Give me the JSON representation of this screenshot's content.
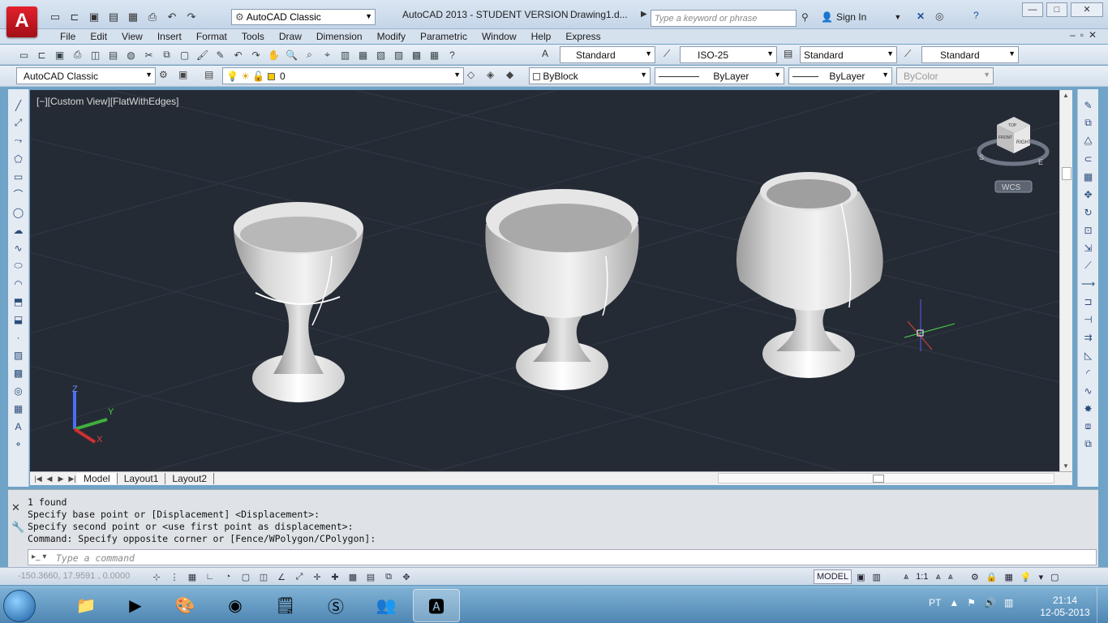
{
  "window": {
    "title": "AutoCAD 2013 - STUDENT VERSION",
    "document": "Drawing1.d...",
    "workspace": "AutoCAD Classic",
    "search_placeholder": "Type a keyword or phrase",
    "sign_in": "Sign In",
    "app_logo": "A"
  },
  "menu": [
    "File",
    "Edit",
    "View",
    "Insert",
    "Format",
    "Tools",
    "Draw",
    "Dimension",
    "Modify",
    "Parametric",
    "Window",
    "Help",
    "Express"
  ],
  "toolbar": {
    "text_style": "Standard",
    "dim_style": "ISO-25",
    "table_style": "Standard",
    "multileader_style": "Standard",
    "workspace": "AutoCAD Classic",
    "layer": "0",
    "color": "ByBlock",
    "linetype": "ByLayer",
    "lineweight": "ByLayer",
    "plotstyle": "ByColor"
  },
  "viewport": {
    "label": "[−][Custom View][FlatWithEdges]",
    "viewcube_face": "RIGHT",
    "viewcube_front": "FRONT",
    "viewcube_top": "TOP",
    "compass_s": "S",
    "compass_e": "E",
    "wcs": "WCS",
    "axis_x": "X",
    "axis_y": "Y",
    "axis_z": "Z"
  },
  "tabs": [
    "Model",
    "Layout1",
    "Layout2"
  ],
  "command": {
    "history": [
      "1 found",
      "Specify base point or [Displacement] <Displacement>:",
      "Specify second point or <use first point as displacement>:",
      "Command: Specify opposite corner or [Fence/WPolygon/CPolygon]:"
    ],
    "placeholder": "Type a command"
  },
  "status": {
    "coords": "-150.3660, 17.9591 , 0.0000",
    "model": "MODEL",
    "scale": "1:1"
  },
  "taskbar": {
    "language": "PT",
    "time": "21:14",
    "date": "12-05-2013"
  },
  "colors": {
    "viewport_bg": "#252b35",
    "autocad_red": "#c41a22",
    "ribbon_blue": "#d6e1ee"
  }
}
